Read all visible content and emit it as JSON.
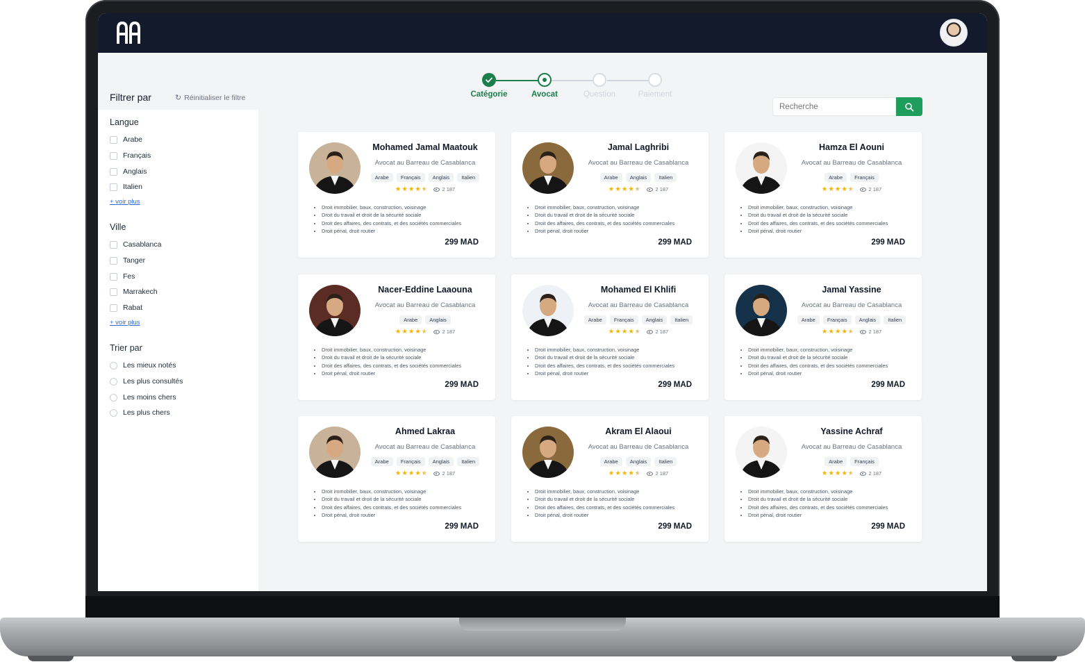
{
  "header": {
    "logo_text": "AA"
  },
  "filters": {
    "title": "Filtrer par",
    "reset_label": "Réinitialiser le filtre",
    "sections": [
      {
        "title": "Langue",
        "type": "checkbox",
        "options": [
          "Arabe",
          "Français",
          "Anglais",
          "Italien"
        ],
        "more": "+ voir plus"
      },
      {
        "title": "Ville",
        "type": "checkbox",
        "options": [
          "Casablanca",
          "Tanger",
          "Fes",
          "Marrakech",
          "Rabat"
        ],
        "more": "+ voir plus"
      },
      {
        "title": "Trier par",
        "type": "radio",
        "options": [
          "Les mieux notés",
          "Les plus consultés",
          "Les moins chers",
          "Les plus chers"
        ]
      }
    ]
  },
  "stepper": {
    "steps": [
      {
        "label": "Catégorie",
        "state": "done"
      },
      {
        "label": "Avocat",
        "state": "current"
      },
      {
        "label": "Question",
        "state": "upcoming"
      },
      {
        "label": "Paiement",
        "state": "upcoming"
      }
    ],
    "active_color": "#1a7f4b",
    "inactive_color": "#d1d5db"
  },
  "search": {
    "placeholder": "Recherche",
    "button_color": "#1f9d5c"
  },
  "lawyers": [
    {
      "name": "Mohamed Jamal Maatouk",
      "title": "Avocat au Barreau de Casablanca",
      "languages": [
        "Arabe",
        "Français",
        "Anglais",
        "Italien"
      ],
      "rating": 4.5,
      "views": "2 187",
      "specialties": [
        "Droit immobilier, baux, construction, voisinage",
        "Droit du travail et droit de la sécurité sociale",
        "Droit des affaires, des contrats, et des sociétés commerciales",
        "Droit pénal, droit routier"
      ],
      "price": "299 MAD",
      "photo_bg": "#c8b39a"
    },
    {
      "name": "Jamal Laghribi",
      "title": "Avocat au Barreau de Casablanca",
      "languages": [
        "Arabe",
        "Anglais",
        "Italien"
      ],
      "rating": 4.5,
      "views": "2 187",
      "specialties": [
        "Droit immobilier, baux, construction, voisinage",
        "Droit du travail et droit de la sécurité sociale",
        "Droit des affaires, des contrats, et des sociétés commerciales",
        "Droit pénal, droit routier"
      ],
      "price": "299 MAD",
      "photo_bg": "#8a6a3c"
    },
    {
      "name": "Hamza El Aouni",
      "title": "Avocat au Barreau de Casablanca",
      "languages": [
        "Arabe",
        "Français"
      ],
      "rating": 4.5,
      "views": "2 187",
      "specialties": [
        "Droit immobilier, baux, construction, voisinage",
        "Droit du travail et droit de la sécurité sociale",
        "Droit des affaires, des contrats, et des sociétés commerciales",
        "Droit pénal, droit routier"
      ],
      "price": "299 MAD",
      "photo_bg": "#f4f4f4"
    },
    {
      "name": "Nacer-Eddine Laaouna",
      "title": "Avocat au Barreau de Casablanca",
      "languages": [
        "Arabe",
        "Anglais"
      ],
      "rating": 4.5,
      "views": "2 187",
      "specialties": [
        "Droit immobilier, baux, construction, voisinage",
        "Droit du travail et droit de la sécurité sociale",
        "Droit des affaires, des contrats, et des sociétés commerciales",
        "Droit pénal, droit routier"
      ],
      "price": "299 MAD",
      "photo_bg": "#5b2c24"
    },
    {
      "name": "Mohamed El Khlifi",
      "title": "Avocat au Barreau de Casablanca",
      "languages": [
        "Arabe",
        "Français",
        "Anglais",
        "Italien"
      ],
      "rating": 4.5,
      "views": "2 187",
      "specialties": [
        "Droit immobilier, baux, construction, voisinage",
        "Droit du travail et droit de la sécurité sociale",
        "Droit des affaires, des contrats, et des sociétés commerciales",
        "Droit pénal, droit routier"
      ],
      "price": "299 MAD",
      "photo_bg": "#eef2f6"
    },
    {
      "name": "Jamal Yassine",
      "title": "Avocat au Barreau de Casablanca",
      "languages": [
        "Arabe",
        "Français",
        "Anglais",
        "Italien"
      ],
      "rating": 4.5,
      "views": "2 187",
      "specialties": [
        "Droit immobilier, baux, construction, voisinage",
        "Droit du travail et droit de la sécurité sociale",
        "Droit des affaires, des contrats, et des sociétés commerciales",
        "Droit pénal, droit routier"
      ],
      "price": "299 MAD",
      "photo_bg": "#16324a"
    },
    {
      "name": "Ahmed Lakraa",
      "title": "Avocat au Barreau de Casablanca",
      "languages": [
        "Arabe",
        "Français",
        "Anglais",
        "Italien"
      ],
      "rating": 4.5,
      "views": "2 187",
      "specialties": [
        "Droit immobilier, baux, construction, voisinage",
        "Droit du travail et droit de la sécurité sociale",
        "Droit des affaires, des contrats, et des sociétés commerciales",
        "Droit pénal, droit routier"
      ],
      "price": "299 MAD",
      "photo_bg": "#c8b39a"
    },
    {
      "name": "Akram El Alaoui",
      "title": "Avocat au Barreau de Casablanca",
      "languages": [
        "Arabe",
        "Anglais",
        "Italien"
      ],
      "rating": 4.5,
      "views": "2 187",
      "specialties": [
        "Droit immobilier, baux, construction, voisinage",
        "Droit du travail et droit de la sécurité sociale",
        "Droit des affaires, des contrats, et des sociétés commerciales",
        "Droit pénal, droit routier"
      ],
      "price": "299 MAD",
      "photo_bg": "#8a6a3c"
    },
    {
      "name": "Yassine Achraf",
      "title": "Avocat au Barreau de Casablanca",
      "languages": [
        "Arabe",
        "Français"
      ],
      "rating": 4.5,
      "views": "2 187",
      "specialties": [
        "Droit immobilier, baux, construction, voisinage",
        "Droit du travail et droit de la sécurité sociale",
        "Droit des affaires, des contrats, et des sociétés commerciales",
        "Droit pénal, droit routier"
      ],
      "price": "299 MAD",
      "photo_bg": "#f4f4f4"
    }
  ],
  "icons": {
    "reset": "refresh-icon",
    "search": "search-icon",
    "views": "eye-icon",
    "rating": "star-icon",
    "step_done": "check-icon"
  }
}
